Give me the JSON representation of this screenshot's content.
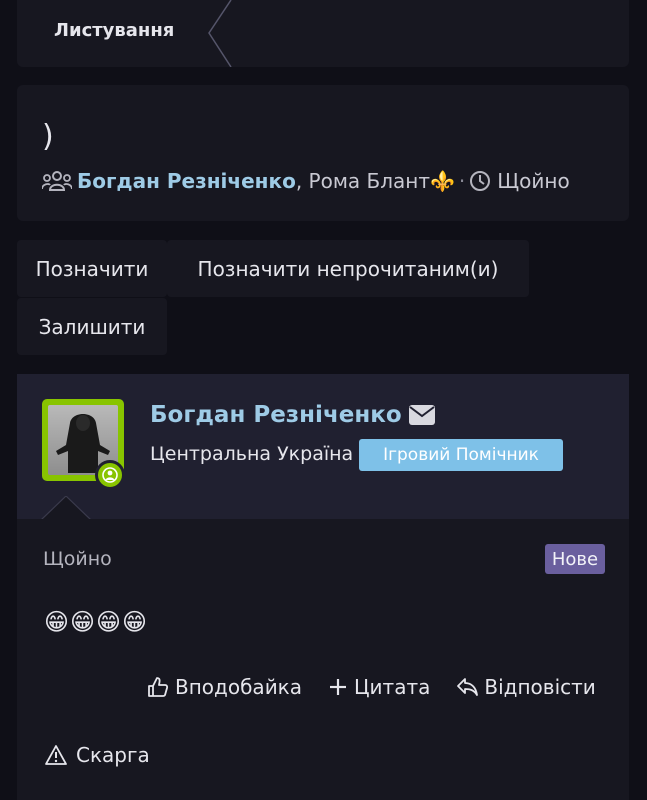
{
  "breadcrumb": {
    "label": "Листування"
  },
  "thread": {
    "title": ")",
    "participants": [
      "Богдан Резніченко",
      "Рома Блант"
    ],
    "participant_separator": ", ",
    "participant_2_emoji": "⚜️",
    "time": "Щойно"
  },
  "actions": {
    "mark": "Позначити",
    "mark_unread": "Позначити непрочитаним(и)",
    "leave": "Залишити"
  },
  "post": {
    "author": "Богдан Резніченко",
    "location": "Центральна Україна",
    "role": "Ігровий Помічник",
    "time": "Щойно",
    "new_badge": "Нове",
    "content": "😁😁😁😁",
    "like_label": "Вподобайка",
    "quote_label": "Цитата",
    "reply_label": "Відповісти",
    "report_label": "Скарга"
  },
  "colors": {
    "accent_link": "#9ecbe6",
    "avatar_border": "#88c400",
    "role_badge": "#7ec1e8",
    "new_badge": "#6a5f9e"
  }
}
